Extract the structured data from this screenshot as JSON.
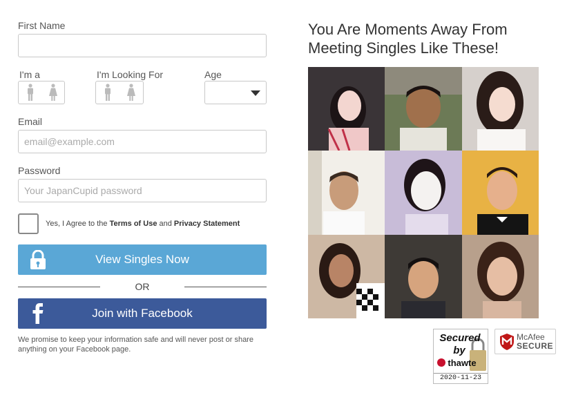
{
  "form": {
    "first_name_label": "First Name",
    "first_name_value": "",
    "iam_label": "I'm a",
    "looking_for_label": "I'm Looking For",
    "age_label": "Age",
    "age_value": "",
    "email_label": "Email",
    "email_placeholder": "email@example.com",
    "password_label": "Password",
    "password_placeholder": "Your JapanCupid password",
    "agree_prefix": "Yes, I Agree to the ",
    "terms_link": "Terms of Use",
    "agree_and": " and ",
    "privacy_link": "Privacy Statement",
    "view_button": "View Singles Now",
    "or_text": "OR",
    "facebook_button": "Join with Facebook",
    "promise_text": "We promise to keep your information safe and will never post or share anything on your Facebook page."
  },
  "showcase": {
    "title": "You Are Moments Away From Meeting Singles Like These!"
  },
  "badges": {
    "thawte_line1": "Secured",
    "thawte_line2": "by",
    "thawte_brand": "thawte",
    "thawte_date": "2020-11-23",
    "mcafee_line1": "McAfee",
    "mcafee_line2": "SECURE"
  },
  "icons": {
    "male": "male-figure-icon",
    "female": "female-figure-icon",
    "lock": "lock-icon",
    "facebook": "facebook-icon",
    "dropdown": "chevron-down-icon"
  },
  "colors": {
    "view_button": "#5aa7d6",
    "facebook_button": "#3c5a9a",
    "mcafee_red": "#c01818",
    "thawte_red": "#c8102e"
  }
}
